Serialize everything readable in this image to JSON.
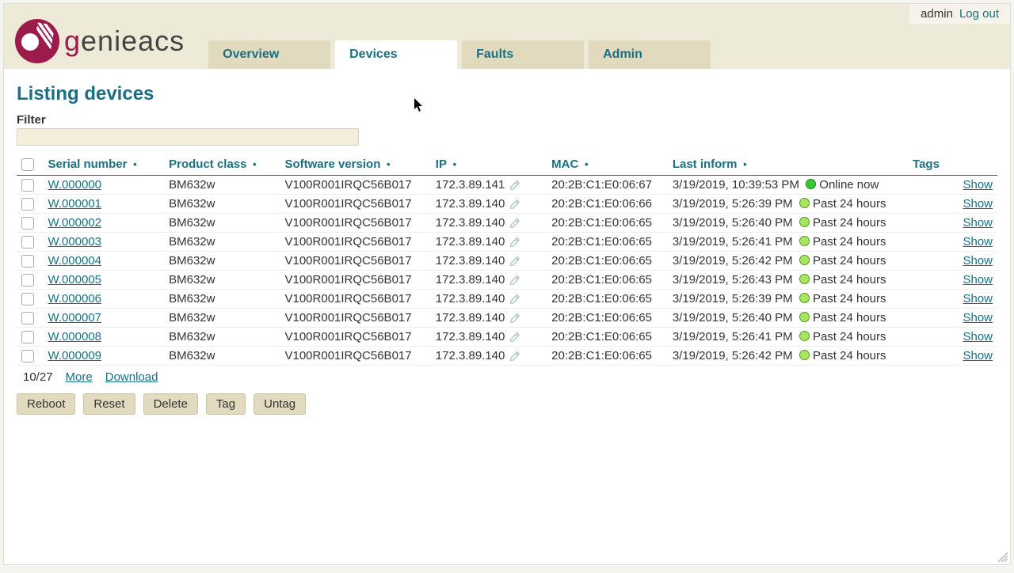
{
  "user": {
    "name": "admin",
    "logout": "Log out"
  },
  "brand": {
    "text_pre": "g",
    "text_rest": "enieacs"
  },
  "tabs": [
    {
      "label": "Overview",
      "active": false
    },
    {
      "label": "Devices",
      "active": true
    },
    {
      "label": "Faults",
      "active": false
    },
    {
      "label": "Admin",
      "active": false
    }
  ],
  "page": {
    "title": "Listing devices",
    "filter_label": "Filter",
    "filter_value": ""
  },
  "columns": {
    "serial": "Serial number",
    "product": "Product class",
    "software": "Software version",
    "ip": "IP",
    "mac": "MAC",
    "last": "Last inform",
    "tags": "Tags"
  },
  "rows": [
    {
      "serial": "W.000000",
      "product": "BM632w",
      "software": "V100R001IRQC56B017",
      "ip": "172.3.89.141",
      "mac": "20:2B:C1:E0:06:67",
      "last": "3/19/2019, 10:39:53 PM",
      "status_kind": "online",
      "status_text": "Online now",
      "show": "Show"
    },
    {
      "serial": "W.000001",
      "product": "BM632w",
      "software": "V100R001IRQC56B017",
      "ip": "172.3.89.140",
      "mac": "20:2B:C1:E0:06:66",
      "last": "3/19/2019, 5:26:39 PM",
      "status_kind": "recent",
      "status_text": "Past 24 hours",
      "show": "Show"
    },
    {
      "serial": "W.000002",
      "product": "BM632w",
      "software": "V100R001IRQC56B017",
      "ip": "172.3.89.140",
      "mac": "20:2B:C1:E0:06:65",
      "last": "3/19/2019, 5:26:40 PM",
      "status_kind": "recent",
      "status_text": "Past 24 hours",
      "show": "Show"
    },
    {
      "serial": "W.000003",
      "product": "BM632w",
      "software": "V100R001IRQC56B017",
      "ip": "172.3.89.140",
      "mac": "20:2B:C1:E0:06:65",
      "last": "3/19/2019, 5:26:41 PM",
      "status_kind": "recent",
      "status_text": "Past 24 hours",
      "show": "Show"
    },
    {
      "serial": "W.000004",
      "product": "BM632w",
      "software": "V100R001IRQC56B017",
      "ip": "172.3.89.140",
      "mac": "20:2B:C1:E0:06:65",
      "last": "3/19/2019, 5:26:42 PM",
      "status_kind": "recent",
      "status_text": "Past 24 hours",
      "show": "Show"
    },
    {
      "serial": "W.000005",
      "product": "BM632w",
      "software": "V100R001IRQC56B017",
      "ip": "172.3.89.140",
      "mac": "20:2B:C1:E0:06:65",
      "last": "3/19/2019, 5:26:43 PM",
      "status_kind": "recent",
      "status_text": "Past 24 hours",
      "show": "Show"
    },
    {
      "serial": "W.000006",
      "product": "BM632w",
      "software": "V100R001IRQC56B017",
      "ip": "172.3.89.140",
      "mac": "20:2B:C1:E0:06:65",
      "last": "3/19/2019, 5:26:39 PM",
      "status_kind": "recent",
      "status_text": "Past 24 hours",
      "show": "Show"
    },
    {
      "serial": "W.000007",
      "product": "BM632w",
      "software": "V100R001IRQC56B017",
      "ip": "172.3.89.140",
      "mac": "20:2B:C1:E0:06:65",
      "last": "3/19/2019, 5:26:40 PM",
      "status_kind": "recent",
      "status_text": "Past 24 hours",
      "show": "Show"
    },
    {
      "serial": "W.000008",
      "product": "BM632w",
      "software": "V100R001IRQC56B017",
      "ip": "172.3.89.140",
      "mac": "20:2B:C1:E0:06:65",
      "last": "3/19/2019, 5:26:41 PM",
      "status_kind": "recent",
      "status_text": "Past 24 hours",
      "show": "Show"
    },
    {
      "serial": "W.000009",
      "product": "BM632w",
      "software": "V100R001IRQC56B017",
      "ip": "172.3.89.140",
      "mac": "20:2B:C1:E0:06:65",
      "last": "3/19/2019, 5:26:42 PM",
      "status_kind": "recent",
      "status_text": "Past 24 hours",
      "show": "Show"
    }
  ],
  "footer": {
    "count": "10/27",
    "more": "More",
    "download": "Download"
  },
  "actions": {
    "reboot": "Reboot",
    "reset": "Reset",
    "delete": "Delete",
    "tag": "Tag",
    "untag": "Untag"
  }
}
